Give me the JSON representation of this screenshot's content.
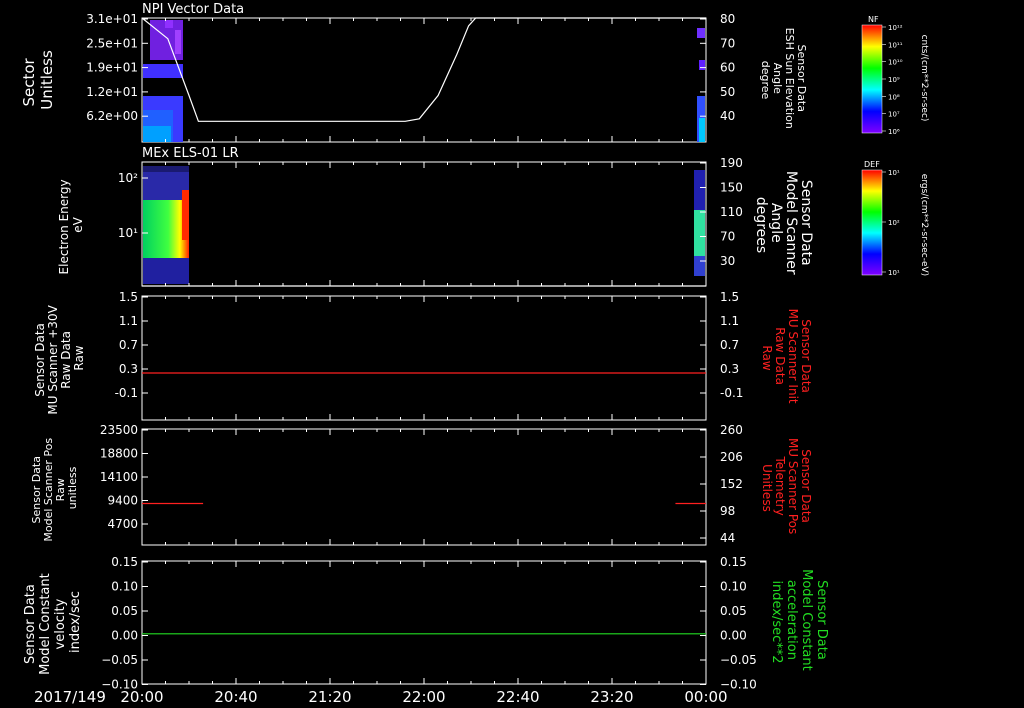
{
  "date_label": "2017/149",
  "x_axis": {
    "ticks": [
      "20:00",
      "20:40",
      "21:20",
      "22:00",
      "22:40",
      "23:20",
      "00:00"
    ]
  },
  "colors": {
    "white": "#ffffff",
    "red": "#ff2020",
    "green": "#22dd22"
  },
  "colorbars": [
    {
      "label": "NF",
      "units": "cnts/(cm**2-sr-sec)",
      "ticks": [
        "10¹²",
        "10¹¹",
        "10¹⁰",
        "10⁹",
        "10⁸",
        "10⁷",
        "10⁶"
      ]
    },
    {
      "label": "DEF",
      "units": "ergs/(cm**2-sr-sec-eV)",
      "ticks": [
        "10¹",
        "10²",
        "10¹"
      ]
    }
  ],
  "chart_data": [
    {
      "type": "heatmap",
      "title": "NPI Vector Data",
      "ylabel": [
        "Sector",
        "Unitless"
      ],
      "yticks": [
        "3.1e+01",
        "2.5e+01",
        "1.9e+01",
        "1.2e+01",
        "6.2e+00"
      ],
      "right_ylabel": [
        "Sensor Data",
        "ESH Sun Elevation",
        "Angle",
        "degree"
      ],
      "right_yticks": [
        "80",
        "70",
        "60",
        "50",
        "40"
      ],
      "right_ylim": [
        32,
        80
      ],
      "line_series": {
        "name": "ESH Sun Elevation Angle",
        "x": [
          "20:00",
          "20:11",
          "20:20",
          "20:24",
          "21:52",
          "21:58",
          "22:06",
          "22:14",
          "22:19",
          "22:22",
          "00:00"
        ],
        "values": [
          80,
          72,
          50,
          40,
          40,
          41,
          50,
          66,
          77,
          80,
          80
        ]
      },
      "data_coverage": [
        "20:00-20:20",
        "23:53-00:00"
      ]
    },
    {
      "type": "heatmap",
      "title": "MEx ELS-01 LR",
      "ylabel": [
        "Electron Energy",
        "eV"
      ],
      "yticks": [
        "10²",
        "10¹"
      ],
      "right_ylabel": [
        "Sensor Data",
        "Model Scanner",
        "Angle",
        "degrees"
      ],
      "right_yticks": [
        "190",
        "150",
        "110",
        "70",
        "30"
      ],
      "right_ylim": [
        10,
        190
      ],
      "line_series": {
        "name": "Model Scanner Angle",
        "x": [
          "20:00",
          "00:00"
        ],
        "values": [
          10,
          10
        ]
      },
      "data_coverage": [
        "20:00-20:19",
        "23:53-00:00"
      ]
    },
    {
      "type": "line",
      "ylabel": [
        "Sensor Data",
        "MU Scanner +30V",
        "Raw Data",
        "Raw"
      ],
      "yticks": [
        "1.5",
        "1.1",
        "0.7",
        "0.3",
        "-0.1"
      ],
      "ylim": [
        -0.5,
        1.5
      ],
      "right_ylabel": [
        "Sensor Data",
        "MU Scanner Init",
        "Raw Data",
        "Raw"
      ],
      "right_yticks": [
        "1.5",
        "1.1",
        "0.7",
        "0.3",
        "-0.1"
      ],
      "series": [
        {
          "name": "MU Scanner Init Raw Data",
          "color": "#ff2020",
          "x": [
            "20:00",
            "00:00"
          ],
          "values": [
            0.0,
            0.0
          ]
        }
      ]
    },
    {
      "type": "line",
      "ylabel": [
        "Sensor Data",
        "Model Scanner Pos",
        "Raw",
        "unitless"
      ],
      "yticks": [
        "23500",
        "18800",
        "14100",
        "9400",
        "4700"
      ],
      "ylim": [
        0,
        23500
      ],
      "right_ylabel": [
        "Sensor Data",
        "MU Scanner Pos",
        "Telemetry",
        "Unitless"
      ],
      "right_yticks": [
        "260",
        "206",
        "152",
        "98",
        "44"
      ],
      "series": [
        {
          "name": "MU Scanner Pos Telemetry",
          "color": "#ff2020",
          "x": [
            "20:00",
            "20:26"
          ],
          "values": [
            8400,
            8400
          ]
        },
        {
          "name": "MU Scanner Pos Telemetry",
          "color": "#ff2020",
          "x": [
            "23:47",
            "00:00"
          ],
          "values": [
            8400,
            8400
          ]
        }
      ]
    },
    {
      "type": "line",
      "ylabel": [
        "Sensor Data",
        "Model Constant",
        "velocity",
        "index/sec"
      ],
      "yticks": [
        "0.15",
        "0.10",
        "0.05",
        "0.00",
        "−0.05",
        "−0.10"
      ],
      "ylim": [
        -0.1,
        0.15
      ],
      "right_ylabel": [
        "Sensor Data",
        "Model Constant",
        "acceleration",
        "index/sec**2"
      ],
      "right_yticks": [
        "0.15",
        "0.10",
        "0.05",
        "0.00",
        "−0.05",
        "−0.10"
      ],
      "series": [
        {
          "name": "Model Constant acceleration",
          "color": "#22dd22",
          "x": [
            "20:00",
            "00:00"
          ],
          "values": [
            0.0,
            0.0
          ]
        }
      ]
    }
  ]
}
